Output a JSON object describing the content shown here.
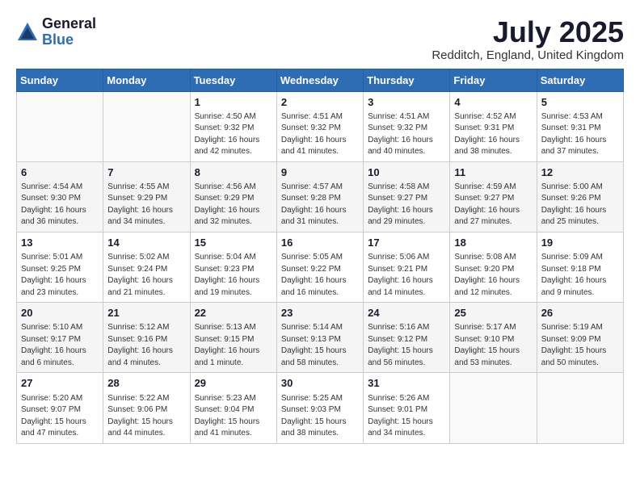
{
  "header": {
    "logo_general": "General",
    "logo_blue": "Blue",
    "month_title": "July 2025",
    "subtitle": "Redditch, England, United Kingdom"
  },
  "weekdays": [
    "Sunday",
    "Monday",
    "Tuesday",
    "Wednesday",
    "Thursday",
    "Friday",
    "Saturday"
  ],
  "weeks": [
    [
      {
        "day": "",
        "info": ""
      },
      {
        "day": "",
        "info": ""
      },
      {
        "day": "1",
        "info": "Sunrise: 4:50 AM\nSunset: 9:32 PM\nDaylight: 16 hours and 42 minutes."
      },
      {
        "day": "2",
        "info": "Sunrise: 4:51 AM\nSunset: 9:32 PM\nDaylight: 16 hours and 41 minutes."
      },
      {
        "day": "3",
        "info": "Sunrise: 4:51 AM\nSunset: 9:32 PM\nDaylight: 16 hours and 40 minutes."
      },
      {
        "day": "4",
        "info": "Sunrise: 4:52 AM\nSunset: 9:31 PM\nDaylight: 16 hours and 38 minutes."
      },
      {
        "day": "5",
        "info": "Sunrise: 4:53 AM\nSunset: 9:31 PM\nDaylight: 16 hours and 37 minutes."
      }
    ],
    [
      {
        "day": "6",
        "info": "Sunrise: 4:54 AM\nSunset: 9:30 PM\nDaylight: 16 hours and 36 minutes."
      },
      {
        "day": "7",
        "info": "Sunrise: 4:55 AM\nSunset: 9:29 PM\nDaylight: 16 hours and 34 minutes."
      },
      {
        "day": "8",
        "info": "Sunrise: 4:56 AM\nSunset: 9:29 PM\nDaylight: 16 hours and 32 minutes."
      },
      {
        "day": "9",
        "info": "Sunrise: 4:57 AM\nSunset: 9:28 PM\nDaylight: 16 hours and 31 minutes."
      },
      {
        "day": "10",
        "info": "Sunrise: 4:58 AM\nSunset: 9:27 PM\nDaylight: 16 hours and 29 minutes."
      },
      {
        "day": "11",
        "info": "Sunrise: 4:59 AM\nSunset: 9:27 PM\nDaylight: 16 hours and 27 minutes."
      },
      {
        "day": "12",
        "info": "Sunrise: 5:00 AM\nSunset: 9:26 PM\nDaylight: 16 hours and 25 minutes."
      }
    ],
    [
      {
        "day": "13",
        "info": "Sunrise: 5:01 AM\nSunset: 9:25 PM\nDaylight: 16 hours and 23 minutes."
      },
      {
        "day": "14",
        "info": "Sunrise: 5:02 AM\nSunset: 9:24 PM\nDaylight: 16 hours and 21 minutes."
      },
      {
        "day": "15",
        "info": "Sunrise: 5:04 AM\nSunset: 9:23 PM\nDaylight: 16 hours and 19 minutes."
      },
      {
        "day": "16",
        "info": "Sunrise: 5:05 AM\nSunset: 9:22 PM\nDaylight: 16 hours and 16 minutes."
      },
      {
        "day": "17",
        "info": "Sunrise: 5:06 AM\nSunset: 9:21 PM\nDaylight: 16 hours and 14 minutes."
      },
      {
        "day": "18",
        "info": "Sunrise: 5:08 AM\nSunset: 9:20 PM\nDaylight: 16 hours and 12 minutes."
      },
      {
        "day": "19",
        "info": "Sunrise: 5:09 AM\nSunset: 9:18 PM\nDaylight: 16 hours and 9 minutes."
      }
    ],
    [
      {
        "day": "20",
        "info": "Sunrise: 5:10 AM\nSunset: 9:17 PM\nDaylight: 16 hours and 6 minutes."
      },
      {
        "day": "21",
        "info": "Sunrise: 5:12 AM\nSunset: 9:16 PM\nDaylight: 16 hours and 4 minutes."
      },
      {
        "day": "22",
        "info": "Sunrise: 5:13 AM\nSunset: 9:15 PM\nDaylight: 16 hours and 1 minute."
      },
      {
        "day": "23",
        "info": "Sunrise: 5:14 AM\nSunset: 9:13 PM\nDaylight: 15 hours and 58 minutes."
      },
      {
        "day": "24",
        "info": "Sunrise: 5:16 AM\nSunset: 9:12 PM\nDaylight: 15 hours and 56 minutes."
      },
      {
        "day": "25",
        "info": "Sunrise: 5:17 AM\nSunset: 9:10 PM\nDaylight: 15 hours and 53 minutes."
      },
      {
        "day": "26",
        "info": "Sunrise: 5:19 AM\nSunset: 9:09 PM\nDaylight: 15 hours and 50 minutes."
      }
    ],
    [
      {
        "day": "27",
        "info": "Sunrise: 5:20 AM\nSunset: 9:07 PM\nDaylight: 15 hours and 47 minutes."
      },
      {
        "day": "28",
        "info": "Sunrise: 5:22 AM\nSunset: 9:06 PM\nDaylight: 15 hours and 44 minutes."
      },
      {
        "day": "29",
        "info": "Sunrise: 5:23 AM\nSunset: 9:04 PM\nDaylight: 15 hours and 41 minutes."
      },
      {
        "day": "30",
        "info": "Sunrise: 5:25 AM\nSunset: 9:03 PM\nDaylight: 15 hours and 38 minutes."
      },
      {
        "day": "31",
        "info": "Sunrise: 5:26 AM\nSunset: 9:01 PM\nDaylight: 15 hours and 34 minutes."
      },
      {
        "day": "",
        "info": ""
      },
      {
        "day": "",
        "info": ""
      }
    ]
  ]
}
